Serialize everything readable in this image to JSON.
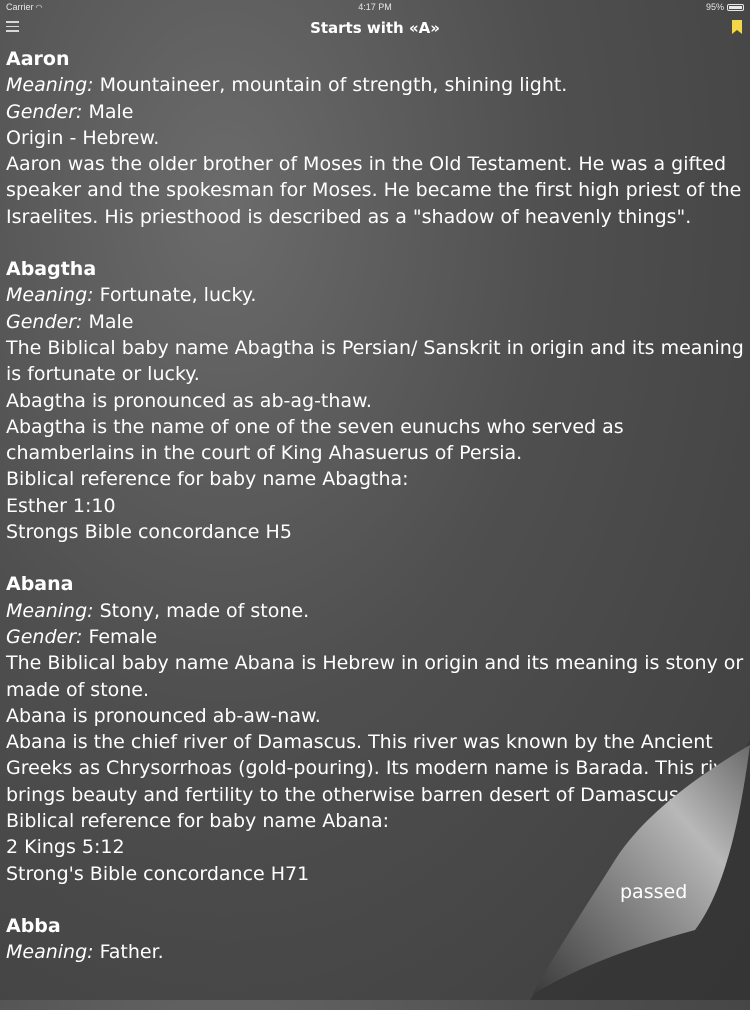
{
  "status": {
    "carrier": "Carrier",
    "time": "4:17 PM",
    "battery": "95%"
  },
  "nav": {
    "title": "Starts with «A»"
  },
  "entries": [
    {
      "name": "Aaron",
      "meaning_label": "Meaning:",
      "meaning": " Mountaineer, mountain of strength, shining light.",
      "gender_label": "Gender:",
      "gender": " Male",
      "lines": [
        "Origin - Hebrew.",
        "Aaron was the older brother of Moses in the Old Testament. He was a gifted speaker and the spokesman for Moses. He became the first high priest of the Israelites. His priesthood is described as a \"shadow of heavenly things\"."
      ]
    },
    {
      "name": "Abagtha",
      "meaning_label": "Meaning:",
      "meaning": " Fortunate, lucky.",
      "gender_label": "Gender:",
      "gender": " Male",
      "lines": [
        "The Biblical baby name Abagtha is Persian/ Sanskrit in origin and its meaning is fortunate or lucky.",
        "Abagtha is pronounced as ab-ag-thaw.",
        "Abagtha is the name of one of the seven eunuchs who served as chamberlains in the court of King Ahasuerus of Persia.",
        "Biblical reference for baby name Abagtha:",
        "Esther 1:10",
        "Strongs Bible concordance H5"
      ]
    },
    {
      "name": "Abana",
      "meaning_label": "Meaning:",
      "meaning": " Stony, made of stone.",
      "gender_label": "Gender:",
      "gender": " Female",
      "lines": [
        "The Biblical baby name Abana is Hebrew in origin and its meaning is stony or made of stone.",
        "Abana is pronounced ab-aw-naw.",
        "Abana is the chief river of Damascus. This river was known by the Ancient Greeks as Chrysorrhoas (gold-pouring). Its modern name is Barada. This river brings beauty and fertility to the otherwise barren desert of Damascus.",
        "Biblical reference for baby name Abana:",
        "2 Kings 5:12",
        "Strong's Bible concordance H71"
      ]
    },
    {
      "name": "Abba",
      "meaning_label": "Meaning:",
      "meaning": " Father.",
      "gender_label": "",
      "gender": "",
      "lines": []
    }
  ],
  "curl_back_text": "passed"
}
